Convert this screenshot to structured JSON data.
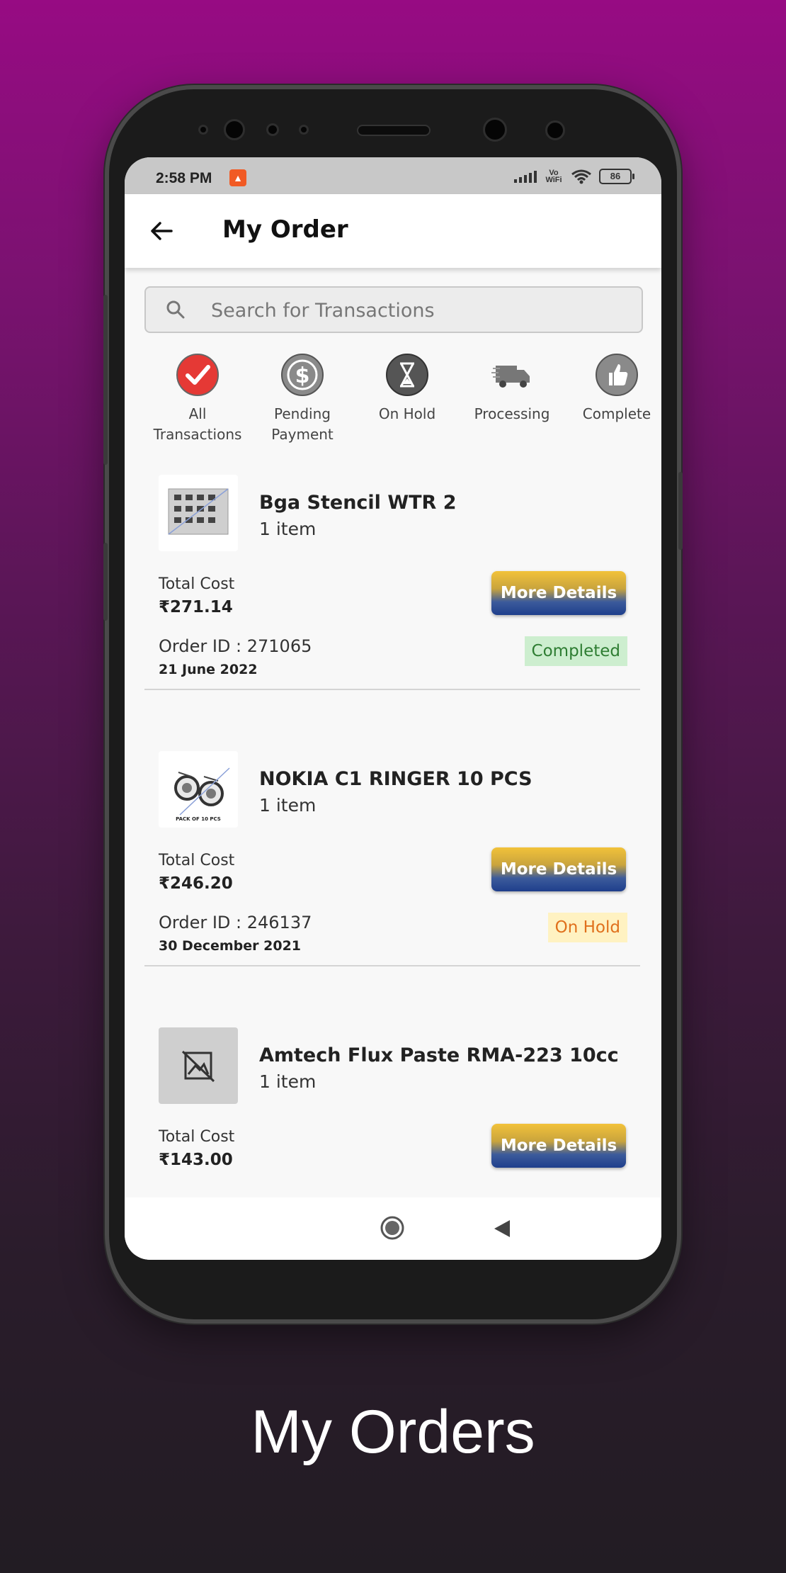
{
  "status_bar": {
    "time": "2:58 PM",
    "network": "Vo WiFi",
    "battery": "86"
  },
  "app_bar": {
    "title": "My Order"
  },
  "search": {
    "placeholder": "Search for Transactions"
  },
  "filters": [
    {
      "label_line1": "All",
      "label_line2": "Transactions",
      "icon": "check-circle-icon",
      "color": "#e53935"
    },
    {
      "label_line1": "Pending",
      "label_line2": "Payment",
      "icon": "dollar-icon",
      "color": "#888888"
    },
    {
      "label_line1": "On Hold",
      "label_line2": "",
      "icon": "hourglass-icon",
      "color": "#555555"
    },
    {
      "label_line1": "Processing",
      "label_line2": "",
      "icon": "truck-icon",
      "color": "#777777"
    },
    {
      "label_line1": "Complete",
      "label_line2": "",
      "icon": "thumbs-up-icon",
      "color": "#888888"
    }
  ],
  "orders": [
    {
      "name": "Bga Stencil WTR 2",
      "items": "1 item",
      "cost_label": "Total Cost",
      "cost": "₹271.14",
      "button": "More Details",
      "order_id": "Order ID : 271065",
      "date": "21 June 2022",
      "status": "Completed"
    },
    {
      "name": "NOKIA C1 RINGER 10 PCS",
      "items": "1 item",
      "cost_label": "Total Cost",
      "cost": "₹246.20",
      "button": "More Details",
      "order_id": "Order ID : 246137",
      "date": "30 December 2021",
      "status": "On Hold",
      "thumb_caption": "PACK OF 10 PCS"
    },
    {
      "name": "Amtech Flux Paste RMA-223 10cc",
      "items": "1 item",
      "cost_label": "Total Cost",
      "cost": "₹143.00",
      "button": "More Details"
    }
  ],
  "caption": "My Orders",
  "colors": {
    "background_top": "#970b83",
    "background_bottom": "#221c23",
    "completed_badge": "#cdeecf",
    "onhold_badge": "#fff2c2",
    "button_gradient_top": "#f2c23a",
    "button_gradient_bottom": "#1f3f8c"
  }
}
